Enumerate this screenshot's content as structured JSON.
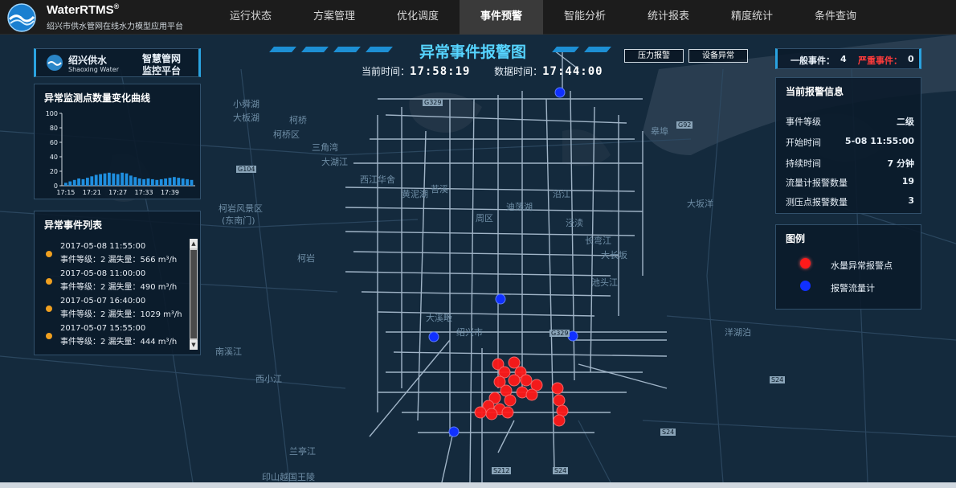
{
  "app": {
    "brand": "WaterRTMS",
    "brand_mark": "®",
    "subtitle": "绍兴市供水管网在线水力模型应用平台"
  },
  "nav": {
    "items": [
      "运行状态",
      "方案管理",
      "优化调度",
      "事件预警",
      "智能分析",
      "统计报表",
      "精度统计",
      "条件查询"
    ],
    "active": "事件预警"
  },
  "brandbox": {
    "company_cn": "绍兴供水",
    "company_en": "Shaoxing Water",
    "platform_line1": "智慧管网",
    "platform_line2": "监控平台"
  },
  "header": {
    "title": "异常事件报警图",
    "current_time_label": "当前时间：",
    "current_time": "17:58:19",
    "data_time_label": "数据时间：",
    "data_time": "17:44:00",
    "btn_pressure": "压力报警",
    "btn_device": "设备异常"
  },
  "chart_data": {
    "type": "bar",
    "title": "异常监测点数量变化曲线",
    "categories": [
      "17:15",
      "17:16",
      "17:17",
      "17:18",
      "17:19",
      "17:20",
      "17:21",
      "17:22",
      "17:23",
      "17:24",
      "17:25",
      "17:26",
      "17:27",
      "17:28",
      "17:29",
      "17:30",
      "17:31",
      "17:32",
      "17:33",
      "17:34",
      "17:35",
      "17:36",
      "17:37",
      "17:38",
      "17:39",
      "17:40",
      "17:41",
      "17:42",
      "17:43",
      "17:44"
    ],
    "x_tick_labels": [
      "17:15",
      "17:21",
      "17:27",
      "17:33",
      "17:39"
    ],
    "values": [
      4,
      6,
      8,
      10,
      9,
      11,
      13,
      15,
      16,
      17,
      18,
      17,
      16,
      18,
      17,
      14,
      12,
      10,
      9,
      10,
      9,
      8,
      9,
      10,
      11,
      12,
      11,
      10,
      9,
      8
    ],
    "ylim": [
      0,
      100
    ],
    "y_ticks": [
      0,
      20,
      40,
      60,
      80,
      100
    ],
    "color": "#1f8fe0"
  },
  "event_list": {
    "title": "异常事件列表",
    "items": [
      {
        "time": "2017-05-08 11:55:00",
        "detail": "事件等级：2  漏失量：566 m³/h"
      },
      {
        "time": "2017-05-08 11:00:00",
        "detail": "事件等级：2  漏失量：490 m³/h"
      },
      {
        "time": "2017-05-07 16:40:00",
        "detail": "事件等级：2  漏失量：1029 m³/h"
      },
      {
        "time": "2017-05-07 15:55:00",
        "detail": "事件等级：2  漏失量：444 m³/h"
      }
    ]
  },
  "counts": {
    "general_label": "一般事件：",
    "general_value": "4",
    "severe_label": "严重事件：",
    "severe_value": "0",
    "severe_color": "#ff3b3b"
  },
  "alarm_info": {
    "title": "当前报警信息",
    "rows": [
      {
        "key": "事件等级",
        "value": "二级"
      },
      {
        "key": "开始时间",
        "value": "5-08 11:55:00"
      },
      {
        "key": "持续时间",
        "value": "7 分钟"
      },
      {
        "key": "流量计报警数量",
        "value": "19"
      },
      {
        "key": "测压点报警数量",
        "value": "3"
      }
    ]
  },
  "legend": {
    "title": "图例",
    "items": [
      {
        "label": "水量异常报警点",
        "color": "#ff1a1a"
      },
      {
        "label": "报警流量计",
        "color": "#1030ff"
      }
    ]
  },
  "map_labels": [
    "小舜湖",
    "大板湖",
    "柯桥区",
    "柯桥",
    "大湖江",
    "西江",
    "华舍",
    "柯岩风景区",
    "(东南门)",
    "三角湾",
    "皋埠",
    "苔溪",
    "柯岩",
    "周区",
    "大坂洋",
    "长弯江",
    "大长坂",
    "池头江",
    "洋湖泊",
    "绍兴市",
    "大溪畈",
    "沿江",
    "兰亭江",
    "印山越国王陵",
    "迪荡湖",
    "泾渎",
    "黄泥湖",
    "西小江",
    "南溪江"
  ],
  "road_badges": [
    "G329",
    "G92",
    "G104",
    "G329",
    "S24",
    "S24",
    "S212",
    "S24"
  ]
}
